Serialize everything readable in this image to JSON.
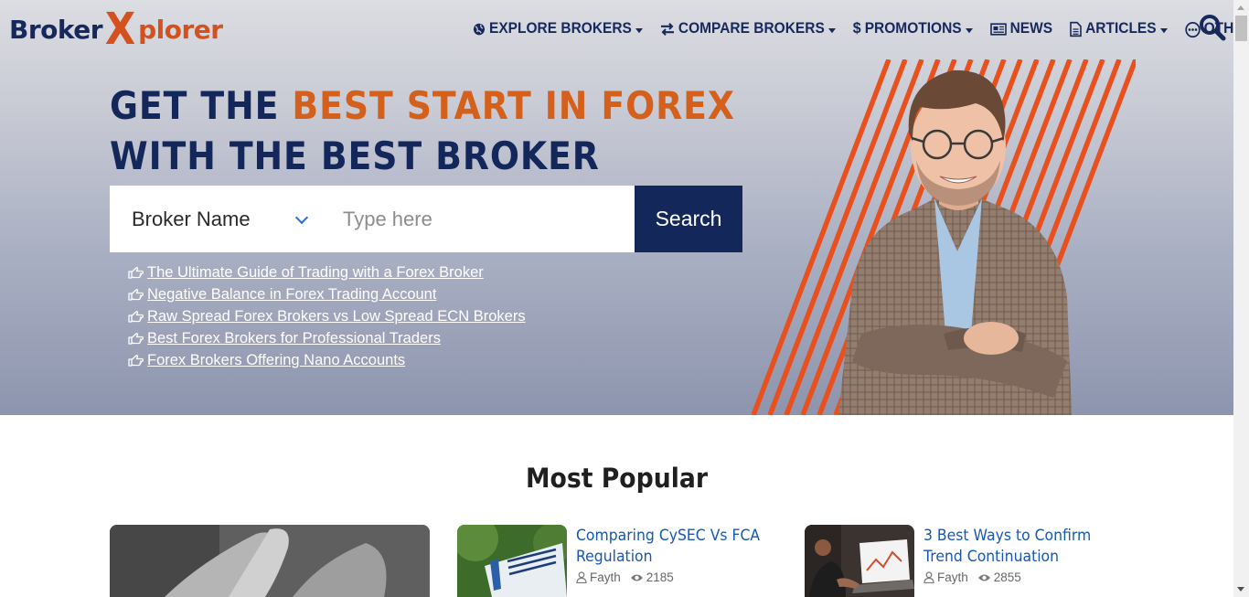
{
  "logo": {
    "part1": "Broker",
    "part2": "X",
    "part3": "plorer"
  },
  "nav": [
    {
      "label": "EXPLORE BROKERS",
      "icon": "globe-icon",
      "dropdown": true
    },
    {
      "label": "COMPARE BROKERS",
      "icon": "exchange-icon",
      "dropdown": true
    },
    {
      "label": "PROMOTIONS",
      "icon": "dollar-icon",
      "dropdown": true
    },
    {
      "label": "NEWS",
      "icon": "newspaper-icon",
      "dropdown": false
    },
    {
      "label": "ARTICLES",
      "icon": "file-icon",
      "dropdown": true
    },
    {
      "label": "OTHERS",
      "icon": "more-icon",
      "dropdown": true
    }
  ],
  "hero": {
    "line1_plain": "GET THE ",
    "line1_accent": "BEST START IN FOREX",
    "line2": "WITH THE BEST BROKER"
  },
  "search": {
    "select_value": "Broker Name",
    "placeholder": "Type here",
    "button_label": "Search"
  },
  "quick_links": [
    "The Ultimate Guide of Trading with a Forex Broker",
    "Negative Balance in Forex Trading Account",
    "Raw Spread Forex Brokers vs Low Spread ECN Brokers",
    "Best Forex Brokers for Professional Traders",
    "Forex Brokers Offering Nano Accounts"
  ],
  "popular": {
    "title": "Most Popular",
    "cards": [
      {
        "title": "Comparing CySEC Vs FCA Regulation",
        "author": "Fayth",
        "views": "2185"
      },
      {
        "title": "3 Best Ways to Confirm Trend Continuation",
        "author": "Fayth",
        "views": "2855"
      }
    ]
  },
  "colors": {
    "navy": "#13275b",
    "orange": "#d4501c",
    "link_blue": "#1657b5"
  }
}
